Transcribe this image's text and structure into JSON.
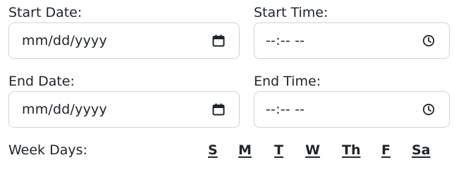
{
  "start_date": {
    "label": "Start Date:",
    "placeholder": "mm/dd/yyyy",
    "icon": "calendar-icon"
  },
  "start_time": {
    "label": "Start Time:",
    "placeholder": "--:-- --",
    "icon": "clock-icon"
  },
  "end_date": {
    "label": "End Date:",
    "placeholder": "mm/dd/yyyy",
    "icon": "calendar-icon"
  },
  "end_time": {
    "label": "End Time:",
    "placeholder": "--:-- --",
    "icon": "clock-icon"
  },
  "week_days": {
    "label": "Week Days:",
    "days": [
      "S",
      "M",
      "T",
      "W",
      "Th",
      "F",
      "Sa"
    ]
  }
}
